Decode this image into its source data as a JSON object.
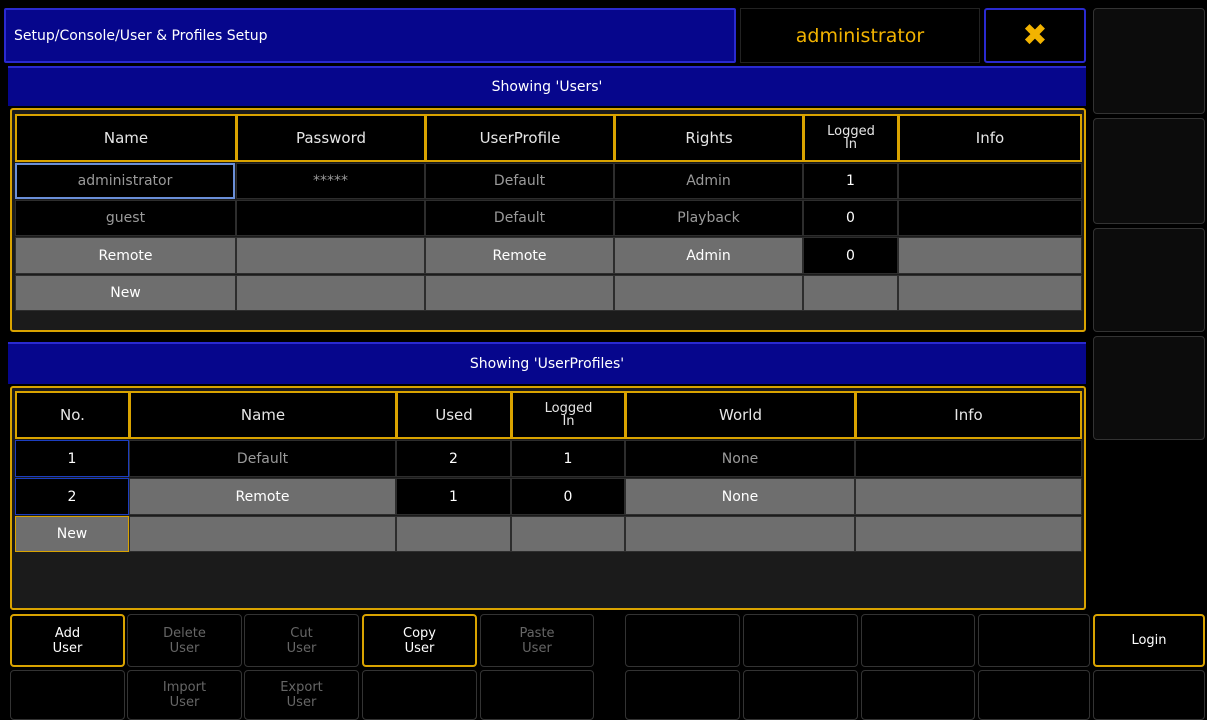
{
  "title": "Setup/Console/User & Profiles Setup",
  "current_user": "administrator",
  "close_glyph": "✖",
  "users": {
    "heading": "Showing 'Users'",
    "columns": [
      "Name",
      "Password",
      "UserProfile",
      "Rights",
      "Logged In",
      "Info"
    ],
    "logged_in_line1": "Logged",
    "logged_in_line2": "In",
    "rows": [
      {
        "name": "administrator",
        "password": "*****",
        "profile": "Default",
        "rights": "Admin",
        "logged_in": "1",
        "info": ""
      },
      {
        "name": "guest",
        "password": "",
        "profile": "Default",
        "rights": "Playback",
        "logged_in": "0",
        "info": ""
      },
      {
        "name": "Remote",
        "password": "",
        "profile": "Remote",
        "rights": "Admin",
        "logged_in": "0",
        "info": ""
      },
      {
        "name": "New",
        "password": "",
        "profile": "",
        "rights": "",
        "logged_in": "",
        "info": ""
      }
    ]
  },
  "profiles": {
    "heading": "Showing 'UserProfiles'",
    "columns": [
      "No.",
      "Name",
      "Used",
      "Logged In",
      "World",
      "Info"
    ],
    "logged_in_line1": "Logged",
    "logged_in_line2": "In",
    "rows": [
      {
        "no": "1",
        "name": "Default",
        "used": "2",
        "logged_in": "1",
        "world": "None",
        "info": ""
      },
      {
        "no": "2",
        "name": "Remote",
        "used": "1",
        "logged_in": "0",
        "world": "None",
        "info": ""
      },
      {
        "no": "New",
        "name": "",
        "used": "",
        "logged_in": "",
        "world": "",
        "info": ""
      }
    ]
  },
  "buttons": {
    "add_user": [
      "Add",
      "User"
    ],
    "delete_user": [
      "Delete",
      "User"
    ],
    "cut_user": [
      "Cut",
      "User"
    ],
    "copy_user": [
      "Copy",
      "User"
    ],
    "paste_user": [
      "Paste",
      "User"
    ],
    "import_user": [
      "Import",
      "User"
    ],
    "export_user": [
      "Export",
      "User"
    ],
    "login": "Login"
  }
}
